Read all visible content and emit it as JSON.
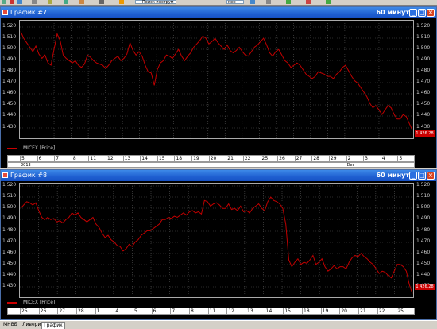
{
  "toolbar": {
    "search_placeholder": "Поиск инструм",
    "interval_value": "мес"
  },
  "windows": [
    {
      "title": "График #7",
      "interval": "60 минут",
      "legend": "MICEX [Price]",
      "last_value": "1 426.28",
      "y_ticks": [
        "1 520",
        "1 510",
        "1 500",
        "1 490",
        "1 480",
        "1 470",
        "1 460",
        "1 450",
        "1 440",
        "1 430"
      ],
      "x_ticks": [
        "5",
        "6",
        "7",
        "8",
        "11",
        "12",
        "13",
        "14",
        "15",
        "18",
        "19",
        "20",
        "21",
        "22",
        "25",
        "26",
        "27",
        "28",
        "29",
        "2",
        "3",
        "4",
        "5"
      ],
      "x_sub": [
        {
          "label": "2013",
          "at": 0
        },
        {
          "label": "Dec",
          "at": 19
        }
      ]
    },
    {
      "title": "График #8",
      "interval": "60 минут",
      "legend": "MICEX [Price]",
      "last_value": "1 426.28",
      "y_ticks": [
        "1 520",
        "1 510",
        "1 500",
        "1 490",
        "1 480",
        "1 470",
        "1 460",
        "1 450",
        "1 440",
        "1 430"
      ],
      "x_ticks": [
        "25",
        "26",
        "27",
        "28",
        "1",
        "4",
        "5",
        "6",
        "7",
        "8",
        "11",
        "12",
        "13",
        "14",
        "15",
        "18",
        "19",
        "20",
        "21",
        "22",
        "25"
      ],
      "x_sub": []
    }
  ],
  "statusbar": {
    "tabs": [
      "МНВБ",
      "Ливери",
      "График"
    ]
  },
  "chart_data": [
    {
      "type": "line",
      "title": "",
      "xlabel": "",
      "ylabel": "",
      "ylim": [
        1420,
        1525
      ],
      "series": [
        {
          "name": "MICEX [Price]",
          "color": "#c00000",
          "values": [
            1516,
            1510,
            1506,
            1502,
            1498,
            1503,
            1496,
            1492,
            1495,
            1488,
            1486,
            1500,
            1514,
            1508,
            1495,
            1492,
            1490,
            1488,
            1490,
            1486,
            1484,
            1487,
            1495,
            1493,
            1490,
            1488,
            1487,
            1486,
            1483,
            1486,
            1490,
            1492,
            1494,
            1490,
            1492,
            1496,
            1506,
            1499,
            1495,
            1498,
            1494,
            1486,
            1480,
            1479,
            1468,
            1482,
            1488,
            1490,
            1495,
            1494,
            1492,
            1496,
            1500,
            1494,
            1490,
            1494,
            1497,
            1502,
            1505,
            1508,
            1512,
            1510,
            1505,
            1507,
            1510,
            1506,
            1503,
            1500,
            1504,
            1499,
            1497,
            1499,
            1502,
            1498,
            1495,
            1494,
            1498,
            1502,
            1504,
            1507,
            1510,
            1504,
            1497,
            1494,
            1498,
            1500,
            1495,
            1490,
            1488,
            1484,
            1486,
            1488,
            1486,
            1482,
            1478,
            1476,
            1474,
            1476,
            1480,
            1479,
            1478,
            1476,
            1476,
            1474,
            1478,
            1480,
            1484,
            1486,
            1481,
            1476,
            1472,
            1470,
            1466,
            1462,
            1458,
            1452,
            1448,
            1450,
            1446,
            1442,
            1446,
            1450,
            1448,
            1442,
            1438,
            1438,
            1442,
            1440,
            1434,
            1428
          ]
        }
      ]
    },
    {
      "type": "line",
      "title": "",
      "xlabel": "",
      "ylabel": "",
      "ylim": [
        1423,
        1521
      ],
      "series": [
        {
          "name": "MICEX [Price]",
          "color": "#c00000",
          "values": [
            1500,
            1503,
            1506,
            1505,
            1503,
            1505,
            1498,
            1492,
            1490,
            1492,
            1490,
            1491,
            1488,
            1489,
            1487,
            1490,
            1492,
            1496,
            1494,
            1496,
            1492,
            1490,
            1488,
            1490,
            1492,
            1486,
            1483,
            1478,
            1474,
            1476,
            1472,
            1470,
            1467,
            1466,
            1462,
            1464,
            1468,
            1466,
            1470,
            1472,
            1476,
            1478,
            1480,
            1480,
            1482,
            1484,
            1486,
            1490,
            1490,
            1492,
            1491,
            1493,
            1492,
            1494,
            1496,
            1494,
            1497,
            1498,
            1496,
            1497,
            1495,
            1507,
            1506,
            1502,
            1504,
            1505,
            1503,
            1500,
            1500,
            1504,
            1499,
            1500,
            1498,
            1502,
            1497,
            1498,
            1496,
            1500,
            1502,
            1504,
            1500,
            1498,
            1506,
            1510,
            1507,
            1506,
            1504,
            1500,
            1486,
            1454,
            1448,
            1452,
            1455,
            1450,
            1452,
            1451,
            1454,
            1458,
            1450,
            1452,
            1455,
            1448,
            1444,
            1446,
            1449,
            1446,
            1448,
            1448,
            1446,
            1452,
            1456,
            1458,
            1457,
            1460,
            1457,
            1455,
            1452,
            1450,
            1446,
            1442,
            1444,
            1443,
            1440,
            1438,
            1444,
            1450,
            1450,
            1448,
            1444,
            1432,
            1424
          ]
        }
      ]
    }
  ]
}
